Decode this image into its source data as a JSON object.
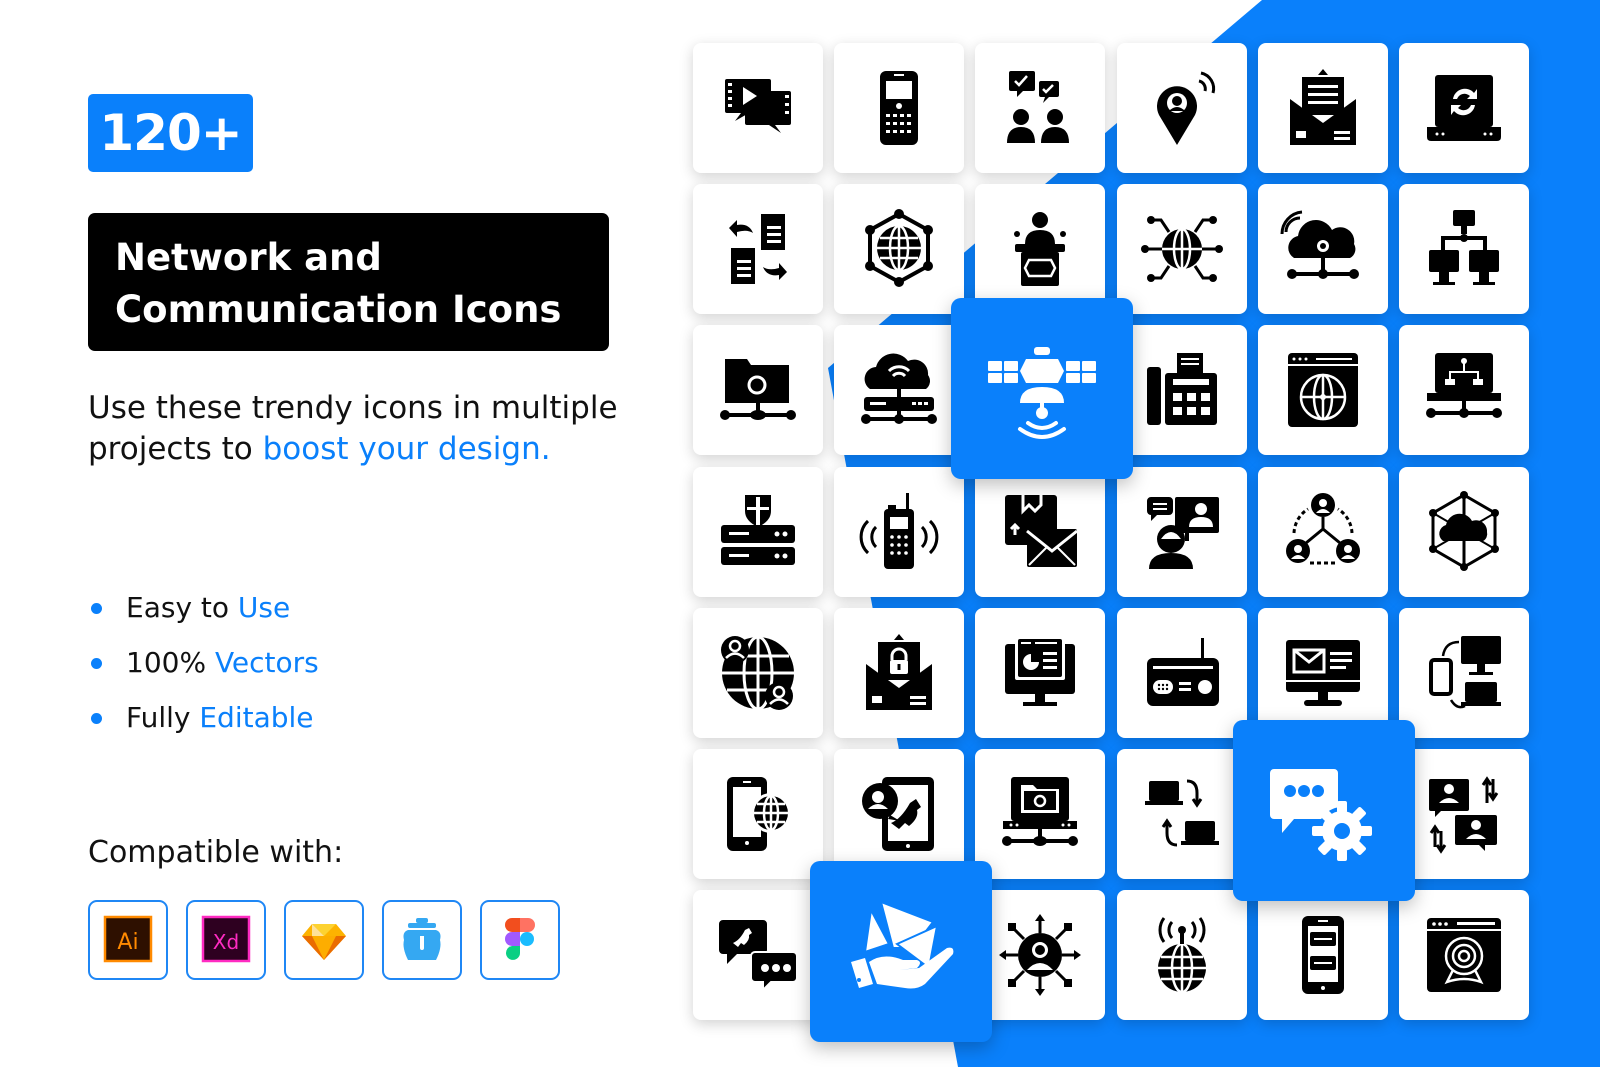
{
  "colors": {
    "accent": "#0a80fb",
    "title_bg": "#000000",
    "text": "#111111",
    "tile_bg": "#ffffff"
  },
  "badge": {
    "label": "120+"
  },
  "title": {
    "line1": "Network and",
    "line2": "Communication Icons"
  },
  "description": {
    "part1": "Use these trendy icons in multiple projects to ",
    "highlight": "boost your design."
  },
  "features": [
    {
      "plain": "Easy to ",
      "highlight": "Use"
    },
    {
      "plain": "100% ",
      "highlight": "Vectors"
    },
    {
      "plain": "Fully ",
      "highlight": "Editable"
    }
  ],
  "compatible": {
    "label": "Compatible with:",
    "apps": [
      {
        "name": "Adobe Illustrator",
        "short": "Ai",
        "icon": "illustrator-icon"
      },
      {
        "name": "Adobe XD",
        "short": "Xd",
        "icon": "xd-icon"
      },
      {
        "name": "Sketch",
        "short": "",
        "icon": "sketch-icon"
      },
      {
        "name": "Iconjar",
        "short": "",
        "icon": "iconjar-icon"
      },
      {
        "name": "Figma",
        "short": "",
        "icon": "figma-icon"
      }
    ]
  },
  "grid": {
    "rows": [
      [
        "video-chat-icon",
        "mobile-phone-icon",
        "group-discussion-icon",
        "location-signal-icon",
        "open-mail-icon",
        "laptop-sync-icon"
      ],
      [
        "file-exchange-icon",
        "global-network-icon",
        "podium-speaker-icon",
        "globe-connection-icon",
        "cloud-wifi-network-icon",
        "computer-network-icon"
      ],
      [
        "shared-folder-icon",
        "cloud-server-icon",
        "satellite-icon",
        "fax-machine-icon",
        "web-globe-icon",
        "laptop-network-icon"
      ],
      [
        "server-security-icon",
        "walkie-talkie-icon",
        "parcel-mail-icon",
        "video-call-icon",
        "user-network-icon",
        "cloud-hexagon-icon"
      ],
      [
        "global-users-icon",
        "secure-mail-icon",
        "monitor-dashboard-icon",
        "radio-icon",
        "monitor-mail-icon",
        "device-sync-icon"
      ],
      [
        "mobile-globe-icon",
        "tablet-call-icon",
        "network-folder-icon",
        "laptop-transfer-icon",
        "chat-settings-icon",
        "chat-users-transfer-icon"
      ],
      [
        "phone-chat-icon",
        "hand-mail-icon",
        "user-share-icon",
        "globe-antenna-icon",
        "mobile-chat-icon",
        "webcam-icon"
      ]
    ],
    "highlighted": [
      "satellite-icon",
      "chat-settings-icon",
      "hand-mail-icon"
    ]
  }
}
